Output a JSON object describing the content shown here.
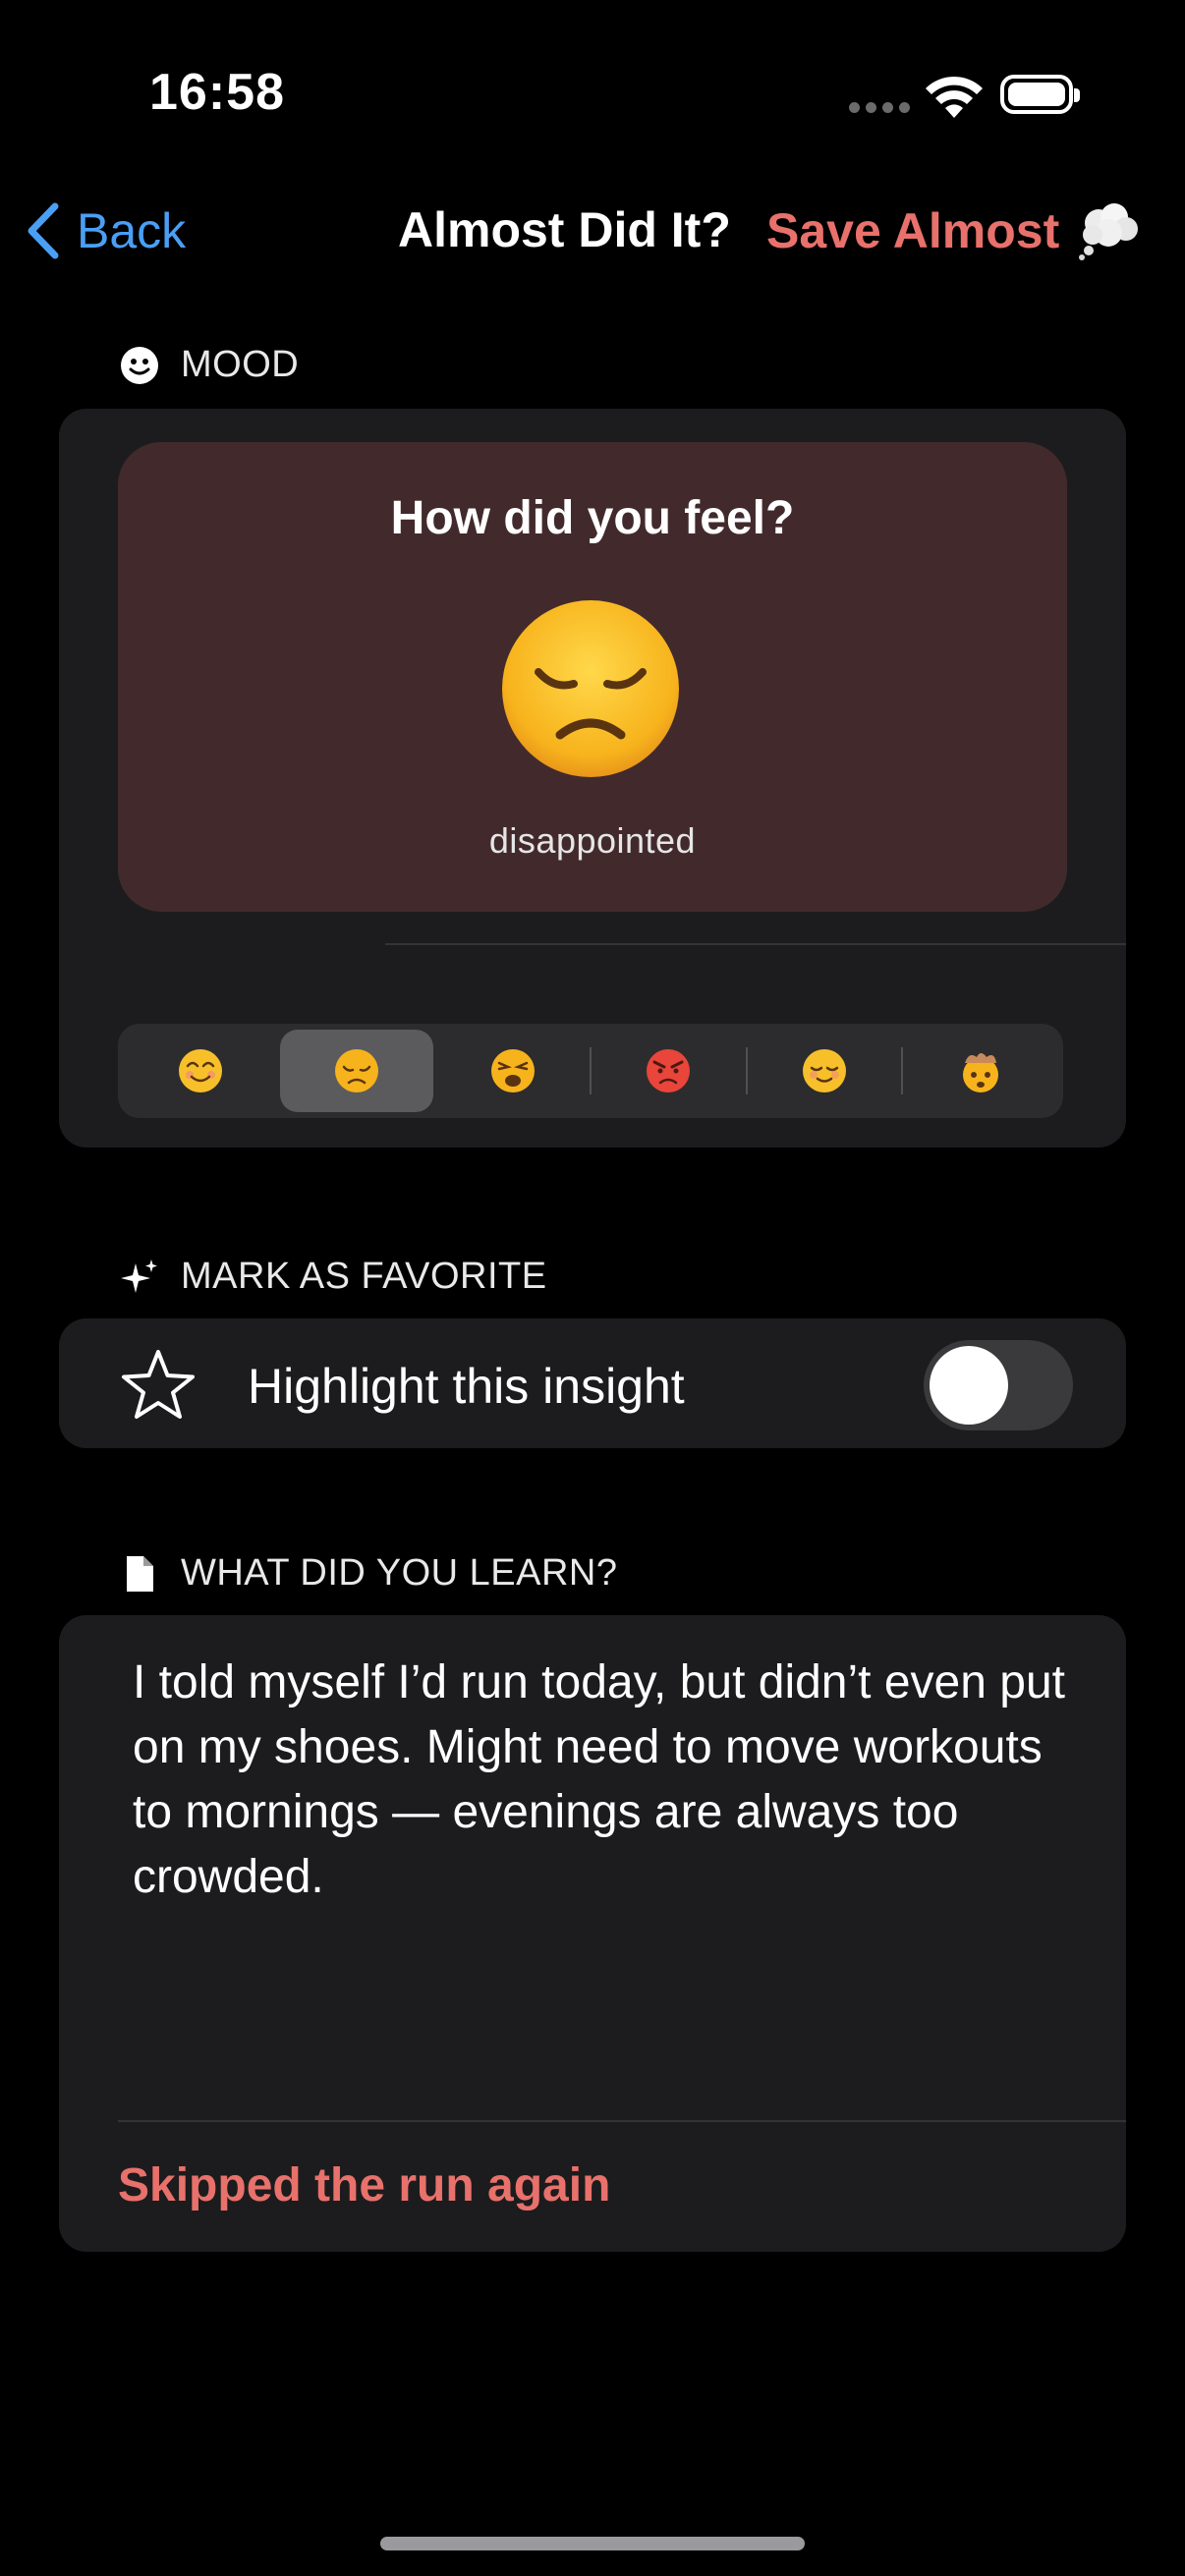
{
  "status_bar": {
    "time": "16:58"
  },
  "nav": {
    "back_label": "Back",
    "title": "Almost Did It?",
    "save_label": "Save Almost",
    "save_icon": "thought-cloud-icon"
  },
  "mood_section": {
    "header": "MOOD",
    "header_icon": "smiley-icon",
    "question": "How did you feel?",
    "selected_emoji": "😞",
    "selected_label": "disappointed",
    "options": [
      {
        "emoji": "😊",
        "name": "smiling"
      },
      {
        "emoji": "😞",
        "name": "disappointed"
      },
      {
        "emoji": "😩",
        "name": "weary"
      },
      {
        "emoji": "😡",
        "name": "angry"
      },
      {
        "emoji": "😌",
        "name": "relieved"
      },
      {
        "emoji": "🤯",
        "name": "exploding-head"
      }
    ],
    "selected_index": 1
  },
  "favorite_section": {
    "header": "MARK AS FAVORITE",
    "header_icon": "sparkles-icon",
    "label": "Highlight this insight",
    "toggle_on": false
  },
  "learn_section": {
    "header": "WHAT DID YOU LEARN?",
    "header_icon": "document-icon",
    "text": "I told myself I’d run today, but didn’t even put on my shoes. Might need to move workouts to mornings — evenings are always too crowded.",
    "tag": "Skipped the run again"
  },
  "colors": {
    "background": "#000000",
    "card": "#1c1c1e",
    "mood_panel": "#422a2c",
    "accent_red": "#e8716b",
    "accent_blue": "#4a9ff5"
  }
}
